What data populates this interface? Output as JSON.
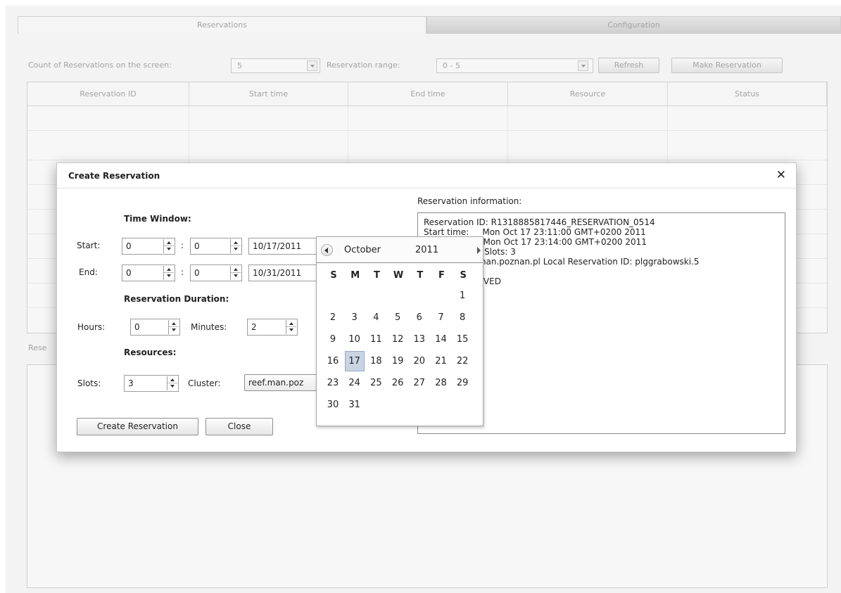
{
  "tabs": [
    {
      "label": "Reservations",
      "active": true
    },
    {
      "label": "Configuration",
      "active": false
    }
  ],
  "toolbar": {
    "count_label": "Count of Reservations on the screen:",
    "count_value": "5",
    "range_label": "Reservation range:",
    "range_value": "0 - 5",
    "refresh_label": "Refresh",
    "make_reservation_label": "Make Reservation"
  },
  "table": {
    "columns": [
      "Reservation ID",
      "Start time",
      "End time",
      "Resource",
      "Status"
    ]
  },
  "lower_section": {
    "label": "Rese"
  },
  "dialog": {
    "title": "Create Reservation",
    "close_icon": "close-icon",
    "time_window_label": "Time Window:",
    "start_label": "Start:",
    "start_hour": "0",
    "start_minute": "0",
    "start_date": "10/17/2011",
    "end_label": "End:",
    "end_hour": "0",
    "end_minute": "0",
    "end_date": "10/31/2011",
    "time_separator": ":",
    "duration_label": "Reservation Duration:",
    "hours_label": "Hours:",
    "hours_value": "0",
    "minutes_label": "Minutes:",
    "minutes_value": "2",
    "resources_label": "Resources:",
    "slots_label": "Slots:",
    "slots_value": "3",
    "cluster_label": "Cluster:",
    "cluster_value": "reef.man.poz",
    "create_button": "Create Reservation",
    "close_button": "Close",
    "info_label": "Reservation information:",
    "info_lines": [
      "Reservation ID: R1318885817446_RESERVATION_0514",
      "Start time:     Mon Oct 17 23:11:00 GMT+0200 2011",
      "End time:       Mon Oct 17 23:14:00 GMT+0200 2011",
      "Resource(s):   Slots: 3",
      "Cluster: reef.man.poznan.pl Local Reservation ID: plggrabowski.5",
      "",
      "Status: RESERVED"
    ]
  },
  "calendar": {
    "month": "October",
    "year": "2011",
    "weekdays": [
      "S",
      "M",
      "T",
      "W",
      "T",
      "F",
      "S"
    ],
    "days": [
      "1",
      "2",
      "3",
      "4",
      "5",
      "6",
      "7",
      "8",
      "9",
      "10",
      "11",
      "12",
      "13",
      "14",
      "15",
      "16",
      "17",
      "18",
      "19",
      "20",
      "21",
      "22",
      "23",
      "24",
      "25",
      "26",
      "27",
      "28",
      "29",
      "30",
      "31"
    ],
    "first_weekday_index": 6,
    "selected_day": "17",
    "selected_color": "#c8d4e3"
  }
}
